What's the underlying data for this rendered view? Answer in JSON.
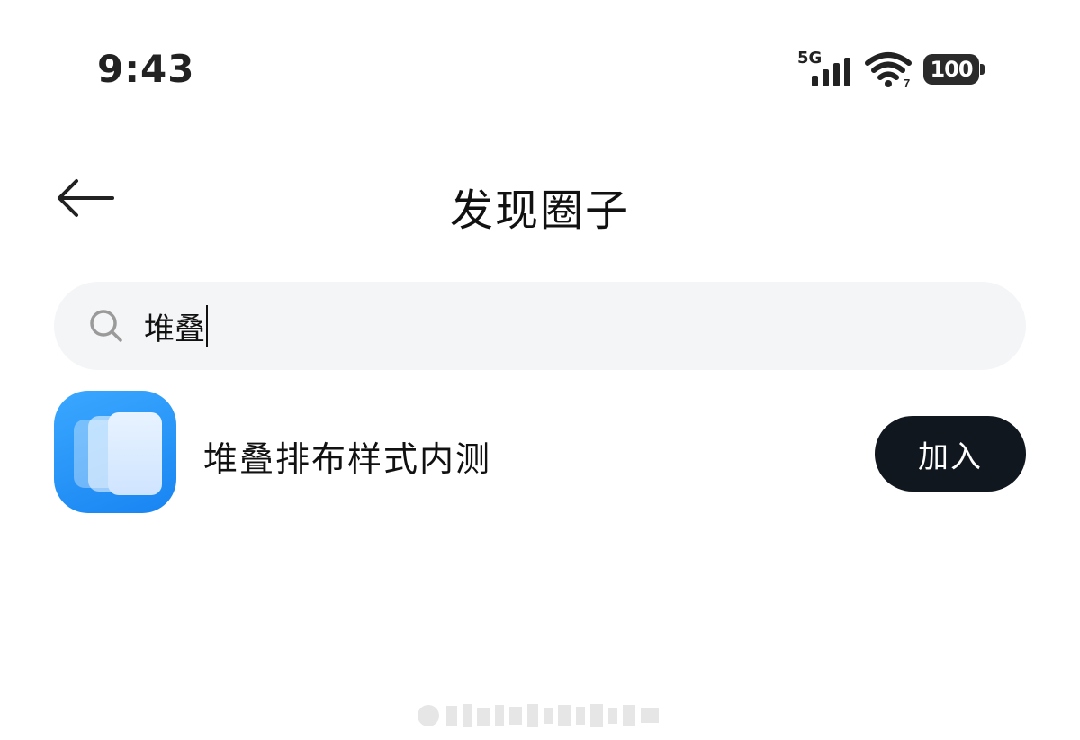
{
  "status_bar": {
    "time": "9:43",
    "network": "5G",
    "battery_level": "100",
    "icons": [
      "signal-icon",
      "wifi-icon",
      "battery-icon"
    ]
  },
  "header": {
    "title": "发现圈子",
    "back_icon": "arrow-left-icon"
  },
  "search": {
    "value": "堆叠",
    "icon": "search-icon"
  },
  "results": [
    {
      "name": "堆叠排布样式内测",
      "icon": "stacked-cards-icon",
      "action_label": "加入"
    }
  ],
  "colors": {
    "accent_button": "#11171f",
    "search_bg": "#f4f5f7",
    "app_icon_blue": "#1f8cf6"
  }
}
